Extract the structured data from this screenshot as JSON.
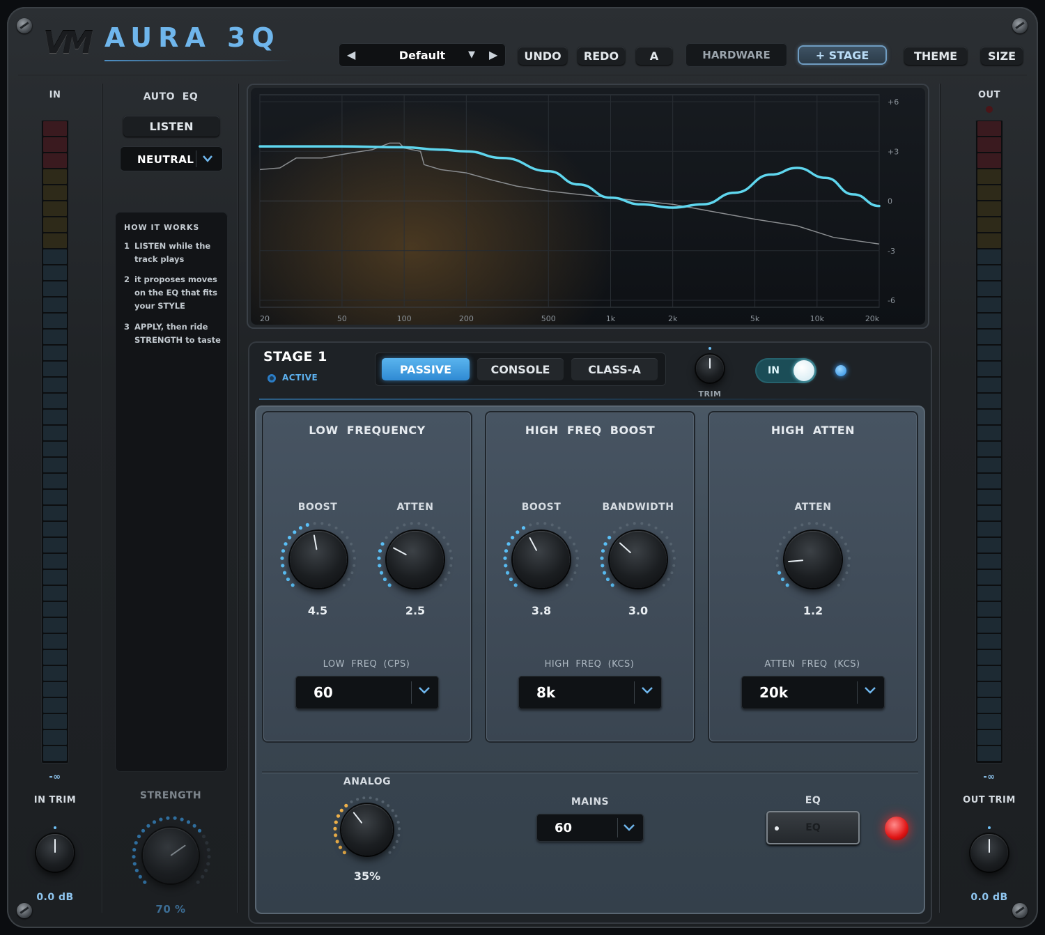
{
  "header": {
    "brand_mark": "VM",
    "product_name": "AURA 3Q",
    "preset": {
      "name": "Default",
      "prev_icon": "triangle-left-icon",
      "next_icon": "triangle-right-icon",
      "menu_icon": "triangle-down-icon"
    },
    "buttons": {
      "undo": "UNDO",
      "redo": "REDO",
      "ab": "A",
      "hardware": "HARDWARE",
      "stage": "+ STAGE",
      "theme": "THEME",
      "size": "SIZE"
    }
  },
  "input": {
    "label": "IN",
    "meter_floor": "-∞",
    "trim_label": "IN TRIM",
    "trim_value": "0.0 dB"
  },
  "output": {
    "label": "OUT",
    "meter_floor": "-∞",
    "trim_label": "OUT TRIM",
    "trim_value": "0.0 dB"
  },
  "auto_eq": {
    "title": "AUTO  EQ",
    "listen": "LISTEN",
    "style": "NEUTRAL",
    "howto_title": "HOW IT WORKS",
    "steps": [
      {
        "n": "1",
        "text": "LISTEN while the track plays"
      },
      {
        "n": "2",
        "text": "it proposes moves on the EQ that fits your STYLE"
      },
      {
        "n": "3",
        "text": "APPLY, then ride STRENGTH to taste"
      }
    ],
    "strength_label": "STRENGTH",
    "strength_value": "70 %"
  },
  "graph": {
    "x_ticks": [
      "20",
      "50",
      "100",
      "200",
      "500",
      "1k",
      "2k",
      "5k",
      "10k",
      "20k"
    ],
    "y_ticks": [
      "+6",
      "+3",
      "0",
      "-3",
      "-6"
    ],
    "colors": {
      "eq_curve": "#5fd6ee",
      "analyzer": "#8a8d90"
    }
  },
  "stage": {
    "title": "STAGE 1",
    "status": "ACTIVE",
    "modes": [
      "PASSIVE",
      "CONSOLE",
      "CLASS-A"
    ],
    "active_mode": "PASSIVE",
    "trim_label": "TRIM",
    "power_label": "IN",
    "sections": [
      {
        "title": "LOW  FREQUENCY",
        "knobs": [
          {
            "label": "BOOST",
            "value": "4.5"
          },
          {
            "label": "ATTEN",
            "value": "2.5"
          }
        ],
        "freq_label": "LOW  FREQ  (CPS)",
        "freq_value": "60"
      },
      {
        "title": "HIGH  FREQ  BOOST",
        "knobs": [
          {
            "label": "BOOST",
            "value": "3.8"
          },
          {
            "label": "BANDWIDTH",
            "value": "3.0"
          }
        ],
        "freq_label": "HIGH  FREQ  (KCS)",
        "freq_value": "8k"
      },
      {
        "title": "HIGH  ATTEN",
        "knobs": [
          {
            "label": "ATTEN",
            "value": "1.2"
          }
        ],
        "freq_label": "ATTEN  FREQ  (KCS)",
        "freq_value": "20k"
      }
    ],
    "analog_label": "ANALOG",
    "analog_value": "35%",
    "mains_label": "MAINS",
    "mains_value": "60",
    "eq_label": "EQ",
    "eq_button": "EQ"
  },
  "colors": {
    "accent_blue": "#3a9fe8",
    "brand_blue": "#6fb6ec",
    "led_red": "#e01515",
    "toggle_on": "#1b4d57"
  }
}
